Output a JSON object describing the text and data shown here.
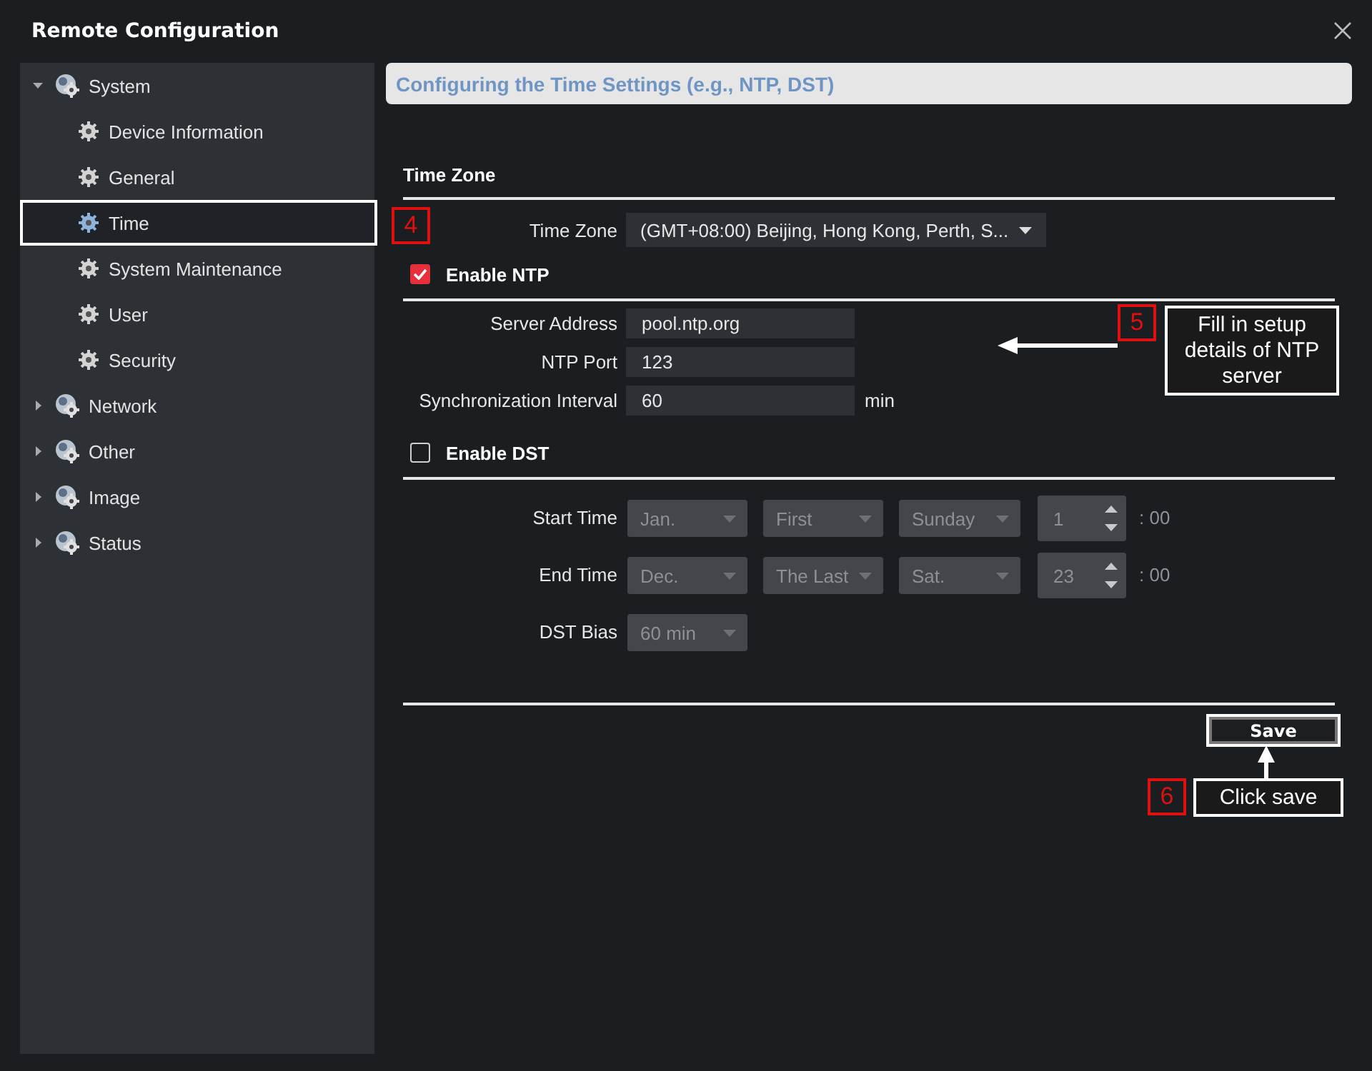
{
  "window": {
    "title": "Remote Configuration"
  },
  "sidebar": {
    "items": [
      {
        "label": "System",
        "expanded": true,
        "selected": false,
        "children": [
          {
            "label": "Device Information",
            "selected": false
          },
          {
            "label": "General",
            "selected": false
          },
          {
            "label": "Time",
            "selected": true
          },
          {
            "label": "System Maintenance",
            "selected": false
          },
          {
            "label": "User",
            "selected": false
          },
          {
            "label": "Security",
            "selected": false
          }
        ]
      },
      {
        "label": "Network",
        "expanded": false,
        "selected": false
      },
      {
        "label": "Other",
        "expanded": false,
        "selected": false
      },
      {
        "label": "Image",
        "expanded": false,
        "selected": false
      },
      {
        "label": "Status",
        "expanded": false,
        "selected": false
      }
    ]
  },
  "header": {
    "title": "Configuring the Time Settings (e.g., NTP, DST)"
  },
  "time_zone": {
    "section_title": "Time Zone",
    "label": "Time Zone",
    "value": "(GMT+08:00) Beijing, Hong Kong, Perth, S..."
  },
  "enable_ntp": {
    "label": "Enable NTP",
    "checked": true
  },
  "ntp_fields": [
    {
      "label": "Server Address",
      "value": "pool.ntp.org"
    },
    {
      "label": "NTP Port",
      "value": "123"
    },
    {
      "label": "Synchronization Interval",
      "value": "60",
      "unit": "min"
    }
  ],
  "enable_dst": {
    "label": "Enable DST",
    "checked": false
  },
  "dst_rows": [
    {
      "kind": "time",
      "label": "Start Time",
      "disabled": true,
      "selects": [
        "Jan.",
        "First",
        "Sunday"
      ],
      "hour": "1",
      "suffix": ": 00"
    },
    {
      "kind": "time",
      "label": "End Time",
      "disabled": true,
      "selects": [
        "Dec.",
        "The Last",
        "Sat."
      ],
      "hour": "23",
      "suffix": ": 00"
    },
    {
      "kind": "bias",
      "label": "DST Bias",
      "disabled": true,
      "selects": [
        "60 min"
      ]
    }
  ],
  "save_button": "Save",
  "annotations": [
    {
      "kind": "step",
      "number": "4"
    },
    {
      "kind": "note",
      "number": "5",
      "text": "Fill in setup details of NTP server"
    },
    {
      "kind": "note",
      "number": "6",
      "text": "Click save"
    }
  ]
}
